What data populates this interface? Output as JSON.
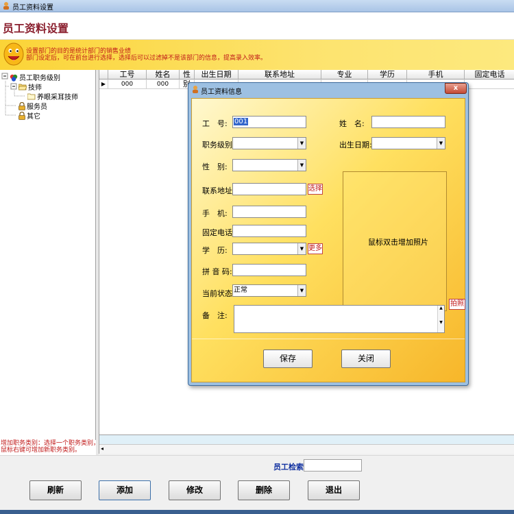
{
  "window": {
    "title": "员工资料设置"
  },
  "header": {
    "title": "员工资料设置"
  },
  "hint": {
    "line1": "设置部门的目的是统计部门的销售业绩",
    "line2": "部门设定后，可在前台进行选择，选择后可以过滤掉不是该部门的信息，提高录入效率。"
  },
  "tree": {
    "root": "员工职务级别",
    "items": [
      {
        "label": "技师",
        "children": [
          "养眼采耳技师"
        ]
      },
      {
        "label": "服务员",
        "children": []
      },
      {
        "label": "其它",
        "children": []
      }
    ]
  },
  "left_hint": {
    "line1": "增加职务类别：选择一个职务类别，",
    "line2": "鼠标右键可增加新职务类别。"
  },
  "grid": {
    "columns": [
      "工号",
      "姓名",
      "性别",
      "出生日期",
      "联系地址",
      "专业",
      "学历",
      "手机",
      "固定电话"
    ],
    "rows": [
      [
        "000",
        "000",
        "",
        "",
        "",
        "",
        "",
        "",
        ""
      ]
    ]
  },
  "search": {
    "label": "员工检索",
    "value": ""
  },
  "buttons": {
    "refresh": "刷新",
    "add": "添加",
    "modify": "修改",
    "delete": "删除",
    "exit": "退出"
  },
  "dialog": {
    "title": "员工资料信息",
    "close": "x",
    "fields": {
      "emp_no_label": "工　号:",
      "emp_no_value": "001",
      "name_label": "姓　名:",
      "name_value": "",
      "rank_label": "职务级别:",
      "rank_value": "",
      "birth_label": "出生日期:",
      "birth_value": "",
      "gender_label": "性　别:",
      "gender_value": "",
      "address_label": "联系地址:",
      "address_value": "",
      "address_btn": "选择",
      "mobile_label": "手　机:",
      "mobile_value": "",
      "phone_label": "固定电话:",
      "phone_value": "",
      "edu_label": "学　历:",
      "edu_value": "",
      "edu_btn": "更多",
      "pinyin_label": "拼 音 码:",
      "pinyin_value": "",
      "status_label": "当前状态:",
      "status_value": "正常",
      "remark_label": "备　注:",
      "remark_value": ""
    },
    "photo_hint": "鼠标双击增加照片",
    "photo_btn": "拍照",
    "save": "保存",
    "close_btn": "关闭"
  }
}
